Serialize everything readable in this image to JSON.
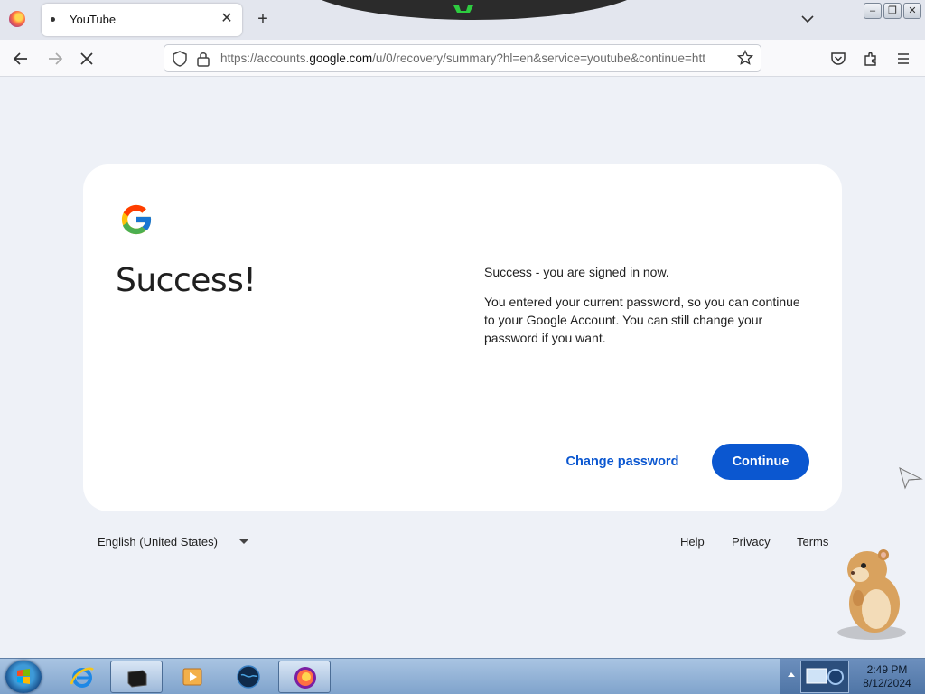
{
  "browser": {
    "tab_title": "YouTube",
    "tab_close": "✕",
    "new_tab": "+",
    "url_prefix": "https://accounts.",
    "url_domain": "google.com",
    "url_suffix": "/u/0/recovery/summary?hl=en&service=youtube&continue=htt"
  },
  "page": {
    "headline": "Success!",
    "message_title": "Success - you are signed in now.",
    "message_body": "You entered your current password, so you can continue to your Google Account. You can still change your password if you want.",
    "change_password_label": "Change password",
    "continue_label": "Continue"
  },
  "footer": {
    "language": "English (United States)",
    "help": "Help",
    "privacy": "Privacy",
    "terms": "Terms"
  },
  "taskbar": {
    "time": "2:49 PM",
    "date": "8/12/2024"
  },
  "colors": {
    "google_blue": "#0b57d0",
    "page_bg": "#eef1f7"
  }
}
